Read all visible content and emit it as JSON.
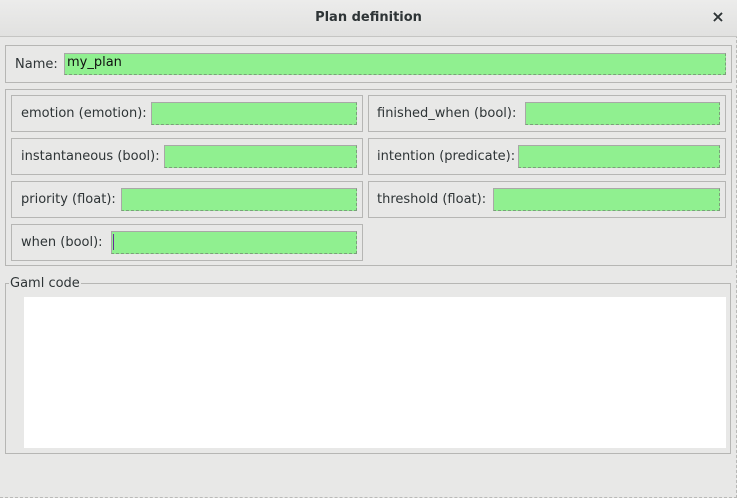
{
  "window": {
    "title": "Plan definition",
    "close_glyph": "×"
  },
  "name_row": {
    "label": "Name:",
    "value": "my_plan"
  },
  "params": [
    {
      "label": "emotion (emotion):",
      "value": ""
    },
    {
      "label": "finished_when (bool):",
      "value": ""
    },
    {
      "label": "instantaneous (bool):",
      "value": ""
    },
    {
      "label": "intention (predicate):",
      "value": ""
    },
    {
      "label": "priority (float):",
      "value": ""
    },
    {
      "label": "threshold (float):",
      "value": ""
    },
    {
      "label": "when (bool):",
      "value": ""
    }
  ],
  "gaml": {
    "legend": "Gaml code",
    "code": ""
  },
  "colors": {
    "field_bg": "#90f090",
    "window_bg": "#e8e8e7"
  }
}
